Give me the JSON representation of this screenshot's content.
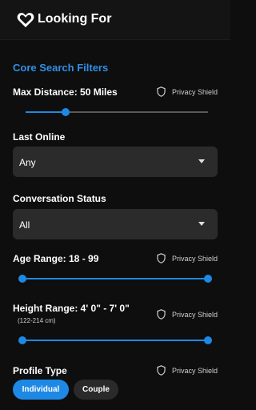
{
  "appbar": {
    "title": "Looking For",
    "logo_icon": "heart-icon"
  },
  "section_title": "Core Search Filters",
  "privacy_shield_label": "Privacy Shield",
  "max_distance": {
    "label": "Max Distance: 50 Miles",
    "value_fraction": 0.22
  },
  "last_online": {
    "label": "Last Online",
    "value": "Any"
  },
  "conversation_status": {
    "label": "Conversation Status",
    "value": "All"
  },
  "age_range": {
    "label": "Age Range: 18 - 99",
    "min_fraction": 0.0,
    "max_fraction": 1.0
  },
  "height_range": {
    "label": "Height Range: 4' 0\" - 7' 0\"",
    "sublabel": "(122-214 cm)",
    "min_fraction": 0.0,
    "max_fraction": 1.0
  },
  "profile_type": {
    "label": "Profile Type",
    "options": [
      {
        "label": "Individual",
        "selected": true
      },
      {
        "label": "Couple",
        "selected": false
      }
    ]
  },
  "colors": {
    "accent": "#1e88e5",
    "section_title": "#2f8fe6",
    "background": "#0e0e0e",
    "select_bg": "#2b2b2b"
  }
}
